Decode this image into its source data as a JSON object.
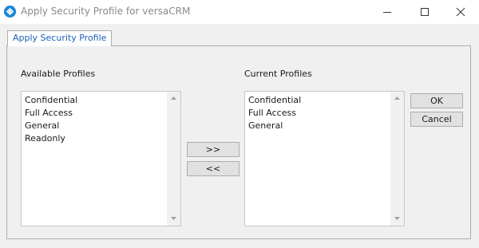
{
  "window": {
    "title": "Apply Security Profile for versaCRM",
    "app_icon": "versacrm-logo-icon",
    "controls": {
      "minimize_icon": "minimize-icon",
      "maximize_icon": "maximize-icon",
      "close_icon": "close-icon"
    }
  },
  "tabs": [
    {
      "label": "Apply Security Profile",
      "active": true
    }
  ],
  "available": {
    "label": "Available Profiles",
    "items": [
      "Confidential",
      "Full Access",
      "General",
      "Readonly"
    ]
  },
  "current": {
    "label": "Current Profiles",
    "items": [
      "Confidential",
      "Full Access",
      "General"
    ]
  },
  "buttons": {
    "add": ">>",
    "remove": "<<",
    "ok": "OK",
    "cancel": "Cancel"
  },
  "colors": {
    "app_icon": "#1e88d6",
    "tab_text": "#1a5fb4",
    "title_text": "#8a8a8a"
  }
}
